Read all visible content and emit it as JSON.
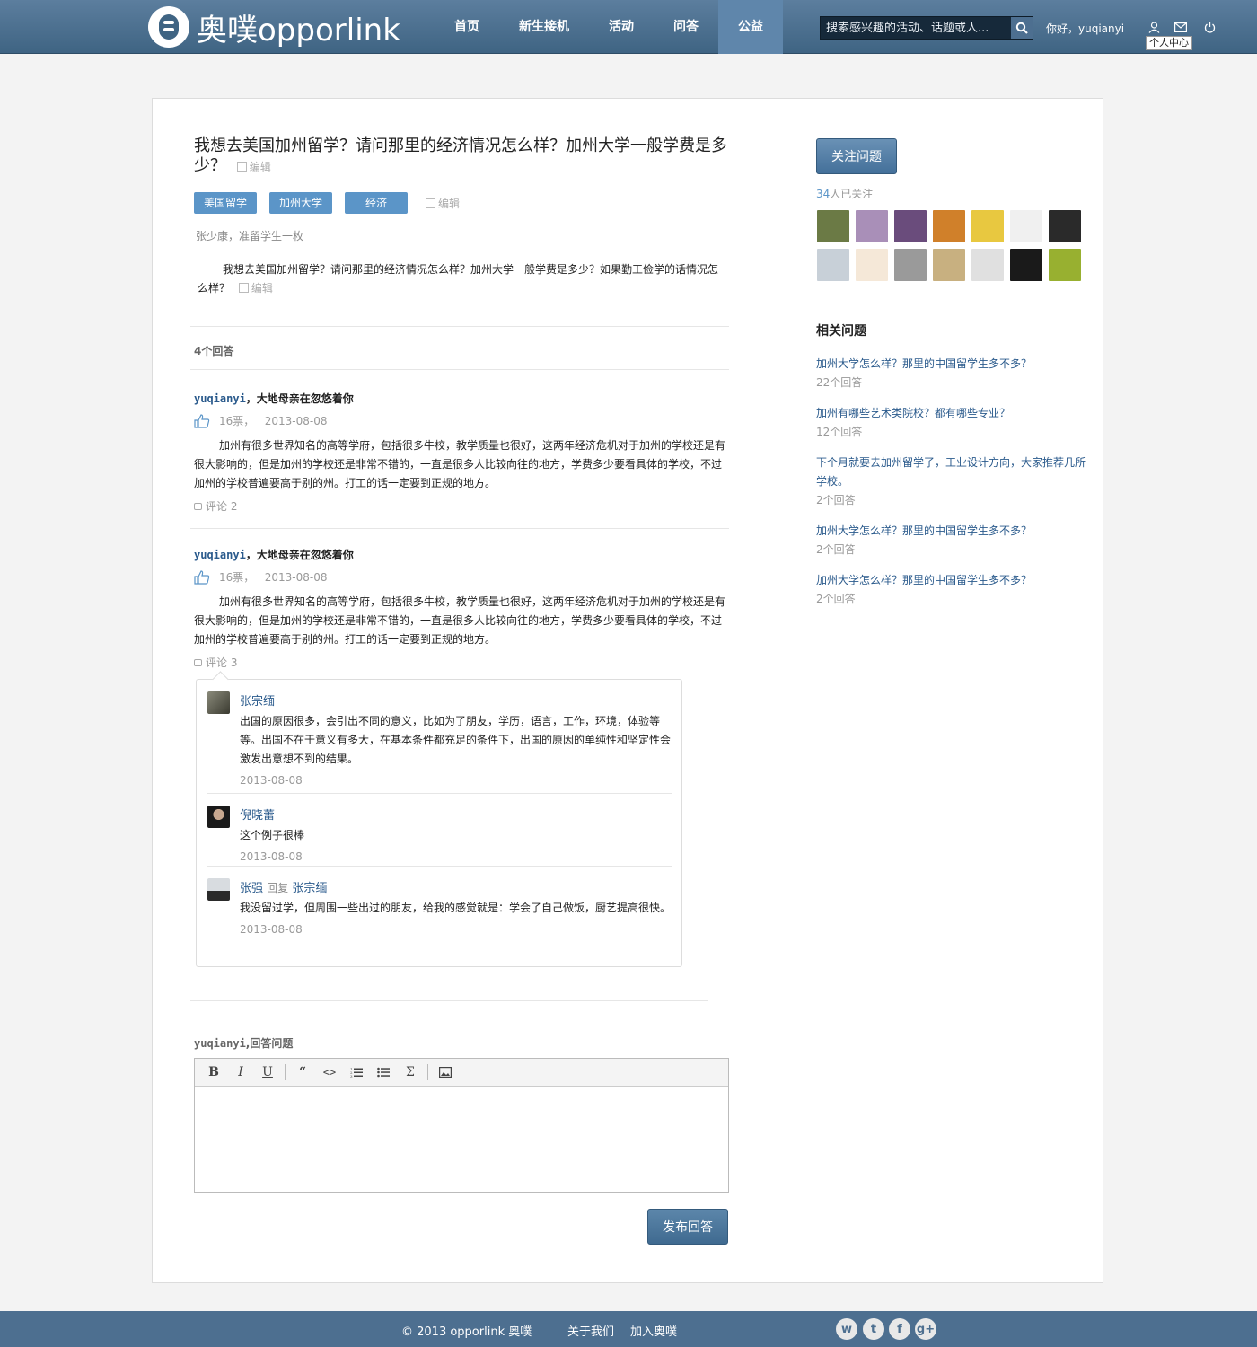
{
  "header": {
    "logo_cn": "奥噗",
    "logo_en": "opporlink",
    "nav": [
      "首页",
      "新生接机",
      "活动",
      "问答",
      "公益"
    ],
    "active_nav": "公益",
    "search_placeholder": "搜索感兴趣的活动、话题或人...",
    "greeting": "你好，yuqianyi",
    "tooltip": "个人中心"
  },
  "question": {
    "title": "我想去美国加州留学？请问那里的经济情况怎么样？加州大学一般学费是多少？",
    "edit_label": "编辑",
    "tags": [
      "美国留学",
      "加州大学",
      "经济"
    ],
    "asker": "张少康，准留学生一枚",
    "body": "我想去美国加州留学？请问那里的经济情况怎么样？加州大学一般学费是多少？如果勤工俭学的话情况怎么样？",
    "answers_count": "4个回答"
  },
  "answers": [
    {
      "user": "yuqianyi",
      "signature": "，大地母亲在忽悠着你",
      "votes": "16票，",
      "date": "2013-08-08",
      "text": "加州有很多世界知名的高等学府，包括很多牛校，教学质量也很好，这两年经济危机对于加州的学校还是有很大影响的，但是加州的学校还是非常不错的，一直是很多人比较向往的地方，学费多少要看具体的学校，不过加州的学校普遍要高于别的州。打工的话一定要到正规的地方。",
      "comments_label": "评论 2"
    },
    {
      "user": "yuqianyi",
      "signature": "，大地母亲在忽悠着你",
      "votes": "16票，",
      "date": "2013-08-08",
      "text": "加州有很多世界知名的高等学府，包括很多牛校，教学质量也很好，这两年经济危机对于加州的学校还是有很大影响的，但是加州的学校还是非常不错的，一直是很多人比较向往的地方，学费多少要看具体的学校，不过加州的学校普遍要高于别的州。打工的话一定要到正规的地方。",
      "comments_label": "评论 3"
    }
  ],
  "comments": [
    {
      "user": "张宗缅",
      "reply_word": "",
      "reply_to": "",
      "text": "出国的原因很多，会引出不同的意义，比如为了朋友，学历，语言，工作，环境，体验等等。出国不在于意义有多大，在基本条件都充足的条件下，出国的原因的单纯性和坚定性会激发出意想不到的结果。",
      "date": "2013-08-08"
    },
    {
      "user": "倪晓蕾",
      "reply_word": "",
      "reply_to": "",
      "text": "这个例子很棒",
      "date": "2013-08-08"
    },
    {
      "user": "张强",
      "reply_word": "回复",
      "reply_to": "张宗缅",
      "text": "我没留过学，但周围一些出过的朋友，给我的感觉就是：学会了自己做饭，厨艺提高很快。",
      "date": "2013-08-08"
    }
  ],
  "reply": {
    "user": "yuqianyi",
    "label": ",回答问题",
    "submit": "发布回答"
  },
  "sidebar": {
    "follow_button": "关注问题",
    "followers_num": "34",
    "followers_suffix": "人已关注",
    "related_title": "相关问题",
    "related": [
      {
        "q": "加州大学怎么样？那里的中国留学生多不多？",
        "count": "22个回答"
      },
      {
        "q": "加州有哪些艺术类院校？都有哪些专业？",
        "count": "12个回答"
      },
      {
        "q": "下个月就要去加州留学了，工业设计方向，大家推荐几所学校。",
        "count": "2个回答"
      },
      {
        "q": "加州大学怎么样？那里的中国留学生多不多？",
        "count": "2个回答"
      },
      {
        "q": "加州大学怎么样？那里的中国留学生多不多？",
        "count": "2个回答"
      }
    ],
    "avatar_colors": [
      "#6b7a45",
      "#a98fb8",
      "#6a4c7c",
      "#d0802a",
      "#e8c840",
      "#f0f0f0",
      "#2a2a2a",
      "#c8d0d8",
      "#f5e8d8",
      "#9a9a9a",
      "#c8b080",
      "#e0e0e0",
      "#1a1a1a",
      "#98b030"
    ]
  },
  "footer": {
    "copyright": "© 2013  opporlink  奥噗",
    "about": "关于我们",
    "join": "加入奥噗",
    "social": [
      "weibo-icon",
      "twitter-icon",
      "facebook-icon",
      "google-plus-icon"
    ]
  },
  "colors": {
    "brand": "#4d6f90",
    "tag": "#5b95c8",
    "link": "#2a5a8c"
  }
}
